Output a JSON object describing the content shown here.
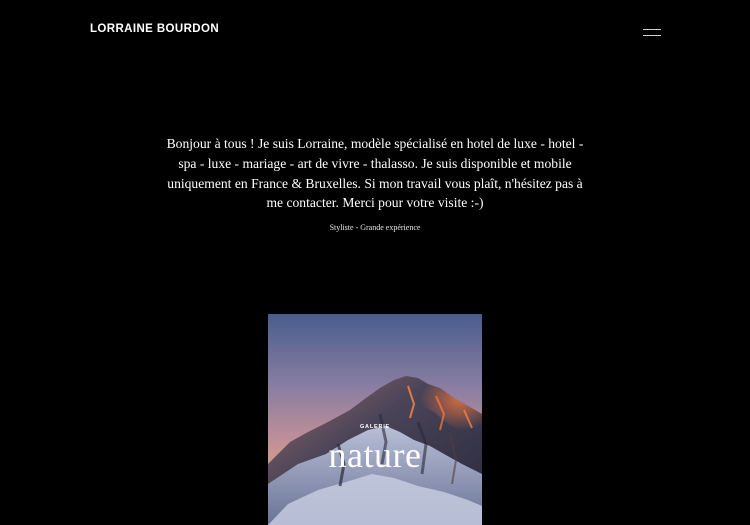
{
  "header": {
    "brand": "LORRAINE BOURDON",
    "menu_icon": "hamburger-menu-icon"
  },
  "intro": {
    "text": "Bonjour à tous ! Je suis Lorraine, modèle spécialisé en hotel de luxe - hotel - spa - luxe - mariage - art de vivre - thalasso. Je suis disponible et mobile uniquement en France & Bruxelles. Si mon travail vous plaît, n'hésitez pas à me contacter. Merci pour votre visite :-)",
    "tagline": "Styliste - Grande expérience"
  },
  "gallery": {
    "eyebrow": "GALERIE",
    "title": "nature"
  },
  "colors": {
    "background": "#000000",
    "text": "#ffffff",
    "sky_top": "#4b5f8f",
    "sky_mid": "#a9839b",
    "sky_glow": "#f0a57e"
  }
}
